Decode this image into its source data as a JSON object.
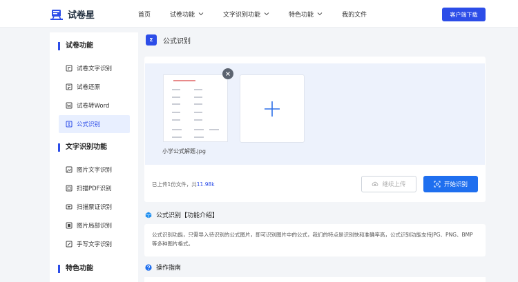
{
  "header": {
    "brand": "试卷星",
    "nav": [
      {
        "label": "首页",
        "has_dropdown": false
      },
      {
        "label": "试卷功能",
        "has_dropdown": true
      },
      {
        "label": "文字识别功能",
        "has_dropdown": true
      },
      {
        "label": "特色功能",
        "has_dropdown": true
      },
      {
        "label": "我的文件",
        "has_dropdown": false
      }
    ],
    "download_label": "客户端下载"
  },
  "sidebar": {
    "groups": [
      {
        "title": "试卷功能",
        "items": [
          {
            "label": "试卷文字识别",
            "icon": "doc-text-icon"
          },
          {
            "label": "试卷还原",
            "icon": "doc-restore-icon"
          },
          {
            "label": "试卷转Word",
            "icon": "doc-word-icon"
          },
          {
            "label": "公式识别",
            "icon": "formula-icon",
            "active": true
          }
        ]
      },
      {
        "title": "文字识别功能",
        "items": [
          {
            "label": "图片文字识别",
            "icon": "image-text-icon"
          },
          {
            "label": "扫描PDF识别",
            "icon": "scan-pdf-icon"
          },
          {
            "label": "扫描票证识别",
            "icon": "ticket-icon"
          },
          {
            "label": "图片局部识别",
            "icon": "crop-icon"
          },
          {
            "label": "手写文字识别",
            "icon": "handwrite-icon"
          }
        ]
      },
      {
        "title": "特色功能",
        "items": []
      }
    ]
  },
  "main": {
    "title": "公式识别",
    "upload": {
      "file_name": "小学公式解题.jpg",
      "status_prefix": "已上传1份文件，共",
      "status_size": "11.98k",
      "continue_label": "继续上传",
      "start_label": "开始识别"
    },
    "intro": {
      "heading": "公式识别【功能介绍】",
      "text": "公式识别功能，只需导入待识别的公式图片，即可识别图片中的公式，我们的特点是识别快和准确率高，公式识别功能支持JPG、PNG、BMP等多种图片格式。"
    },
    "guide": {
      "heading": "操作指南"
    }
  },
  "colors": {
    "primary": "#2c4de8",
    "button_blue": "#1f6fef",
    "drop_zone": "#edf2fc",
    "active_item_bg": "#e8efff",
    "background": "#f3f5f8"
  }
}
